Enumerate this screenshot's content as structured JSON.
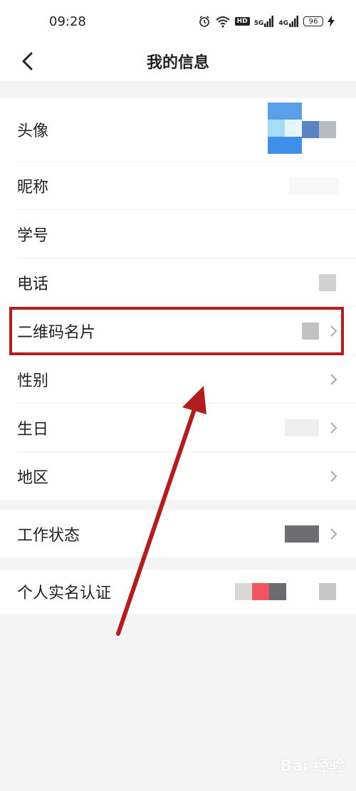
{
  "status_bar": {
    "time": "09:28",
    "signal_1": "5G",
    "signal_2": "4G",
    "battery": "96",
    "hd": "HD"
  },
  "nav": {
    "title": "我的信息",
    "back_icon": "chevron-left-icon"
  },
  "section1": {
    "items": [
      {
        "label": "头像"
      },
      {
        "label": "昵称"
      },
      {
        "label": "学号"
      },
      {
        "label": "电话"
      },
      {
        "label": "二维码名片"
      },
      {
        "label": "性别"
      },
      {
        "label": "生日"
      },
      {
        "label": "地区"
      }
    ]
  },
  "section2": {
    "items": [
      {
        "label": "工作状态"
      }
    ]
  },
  "section3": {
    "items": [
      {
        "label": "个人实名认证"
      }
    ]
  },
  "annotation": {
    "color": "#b01e1e"
  },
  "watermark": "Bai 经验"
}
